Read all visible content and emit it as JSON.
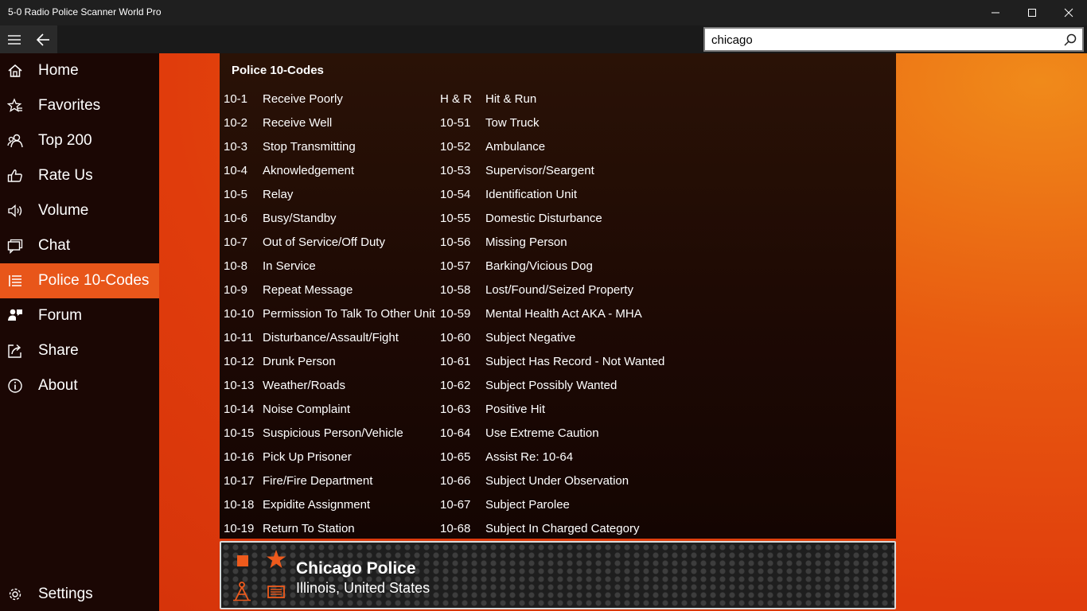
{
  "window": {
    "title": "5-0 Radio Police Scanner World Pro",
    "min_glyph": "—",
    "max_glyph": "☐",
    "close_glyph": "✕"
  },
  "search": {
    "value": "chicago",
    "placeholder": ""
  },
  "sidebar": {
    "items": [
      {
        "label": "Home",
        "icon": "home-icon"
      },
      {
        "label": "Favorites",
        "icon": "favorites-icon"
      },
      {
        "label": "Top 200",
        "icon": "people-icon"
      },
      {
        "label": "Rate Us",
        "icon": "thumbs-up-icon"
      },
      {
        "label": "Volume",
        "icon": "volume-icon"
      },
      {
        "label": "Chat",
        "icon": "chat-icon"
      },
      {
        "label": "Police 10-Codes",
        "icon": "list-icon",
        "active": true
      },
      {
        "label": "Forum",
        "icon": "forum-icon"
      },
      {
        "label": "Share",
        "icon": "share-icon"
      },
      {
        "label": "About",
        "icon": "info-icon"
      }
    ],
    "settings_label": "Settings"
  },
  "codes": {
    "title": "Police 10-Codes",
    "left": [
      [
        "10-1",
        "Receive Poorly"
      ],
      [
        "10-2",
        "Receive Well"
      ],
      [
        "10-3",
        "Stop Transmitting"
      ],
      [
        "10-4",
        "Aknowledgement"
      ],
      [
        "10-5",
        "Relay"
      ],
      [
        "10-6",
        "Busy/Standby"
      ],
      [
        "10-7",
        "Out of Service/Off Duty"
      ],
      [
        "10-8",
        "In Service"
      ],
      [
        "10-9",
        "Repeat Message"
      ],
      [
        "10-10",
        "Permission To Talk To Other Unit"
      ],
      [
        "10-11",
        "Disturbance/Assault/Fight"
      ],
      [
        "10-12",
        "Drunk Person"
      ],
      [
        "10-13",
        "Weather/Roads"
      ],
      [
        "10-14",
        "Noise Complaint"
      ],
      [
        "10-15",
        "Suspicious Person/Vehicle"
      ],
      [
        "10-16",
        "Pick Up Prisoner"
      ],
      [
        "10-17",
        "Fire/Fire Department"
      ],
      [
        "10-18",
        "Expidite Assignment"
      ],
      [
        "10-19",
        "Return To Station"
      ]
    ],
    "right": [
      [
        "H & R",
        "Hit & Run"
      ],
      [
        "10-51",
        "Tow Truck"
      ],
      [
        "10-52",
        "Ambulance"
      ],
      [
        "10-53",
        "Supervisor/Seargent"
      ],
      [
        "10-54",
        "Identification Unit"
      ],
      [
        "10-55",
        "Domestic Disturbance"
      ],
      [
        "10-56",
        "Missing Person"
      ],
      [
        "10-57",
        "Barking/Vicious Dog"
      ],
      [
        "10-58",
        "Lost/Found/Seized Property"
      ],
      [
        "10-59",
        "Mental Health Act AKA - MHA"
      ],
      [
        "10-60",
        "Subject Negative"
      ],
      [
        "10-61",
        "Subject Has Record - Not Wanted"
      ],
      [
        "10-62",
        "Subject Possibly Wanted"
      ],
      [
        "10-63",
        "Positive Hit"
      ],
      [
        "10-64",
        "Use Extreme Caution"
      ],
      [
        "10-65",
        "Assist Re: 10-64"
      ],
      [
        "10-66",
        "Subject Under Observation"
      ],
      [
        "10-67",
        "Subject Parolee"
      ],
      [
        "10-68",
        "Subject In Charged Category"
      ]
    ]
  },
  "player": {
    "station_name": "Chicago Police",
    "location": "Illinois, United States"
  },
  "colors": {
    "accent": "#e8561a",
    "sidebar_bg": "#1b0704",
    "player_icon": "#ee5a1c"
  }
}
